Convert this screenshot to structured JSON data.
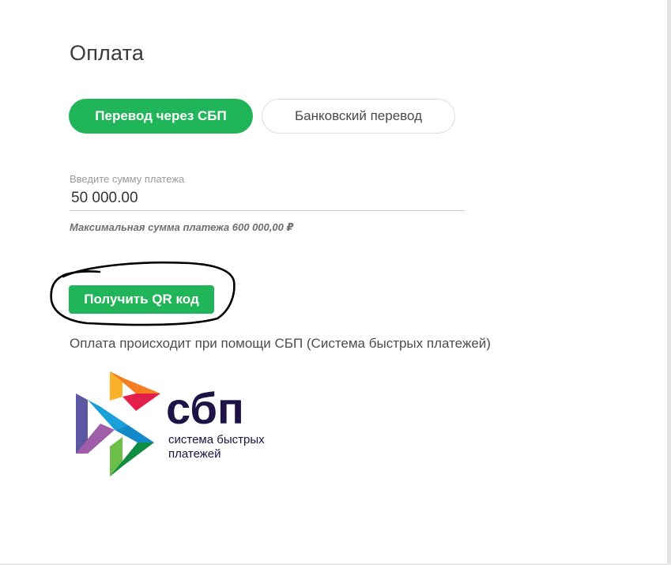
{
  "page": {
    "title": "Оплата"
  },
  "tabs": [
    {
      "label": "Перевод через СБП",
      "active": true
    },
    {
      "label": "Банковский перевод",
      "active": false
    }
  ],
  "amount": {
    "label": "Введите сумму платежа",
    "value": "50 000.00",
    "max_note": "Максимальная сумма платежа 600 000,00 ₽"
  },
  "qr_button": {
    "label": "Получить QR код"
  },
  "info": {
    "text": "Оплата происходит при помощи СБП (Система быстрых платежей)"
  },
  "sbp_logo": {
    "wordmark": "сбп",
    "tagline_line1": "система быстрых",
    "tagline_line2": "платежей"
  },
  "colors": {
    "accent": "#21b55a",
    "logo_text": "#1d1346"
  }
}
